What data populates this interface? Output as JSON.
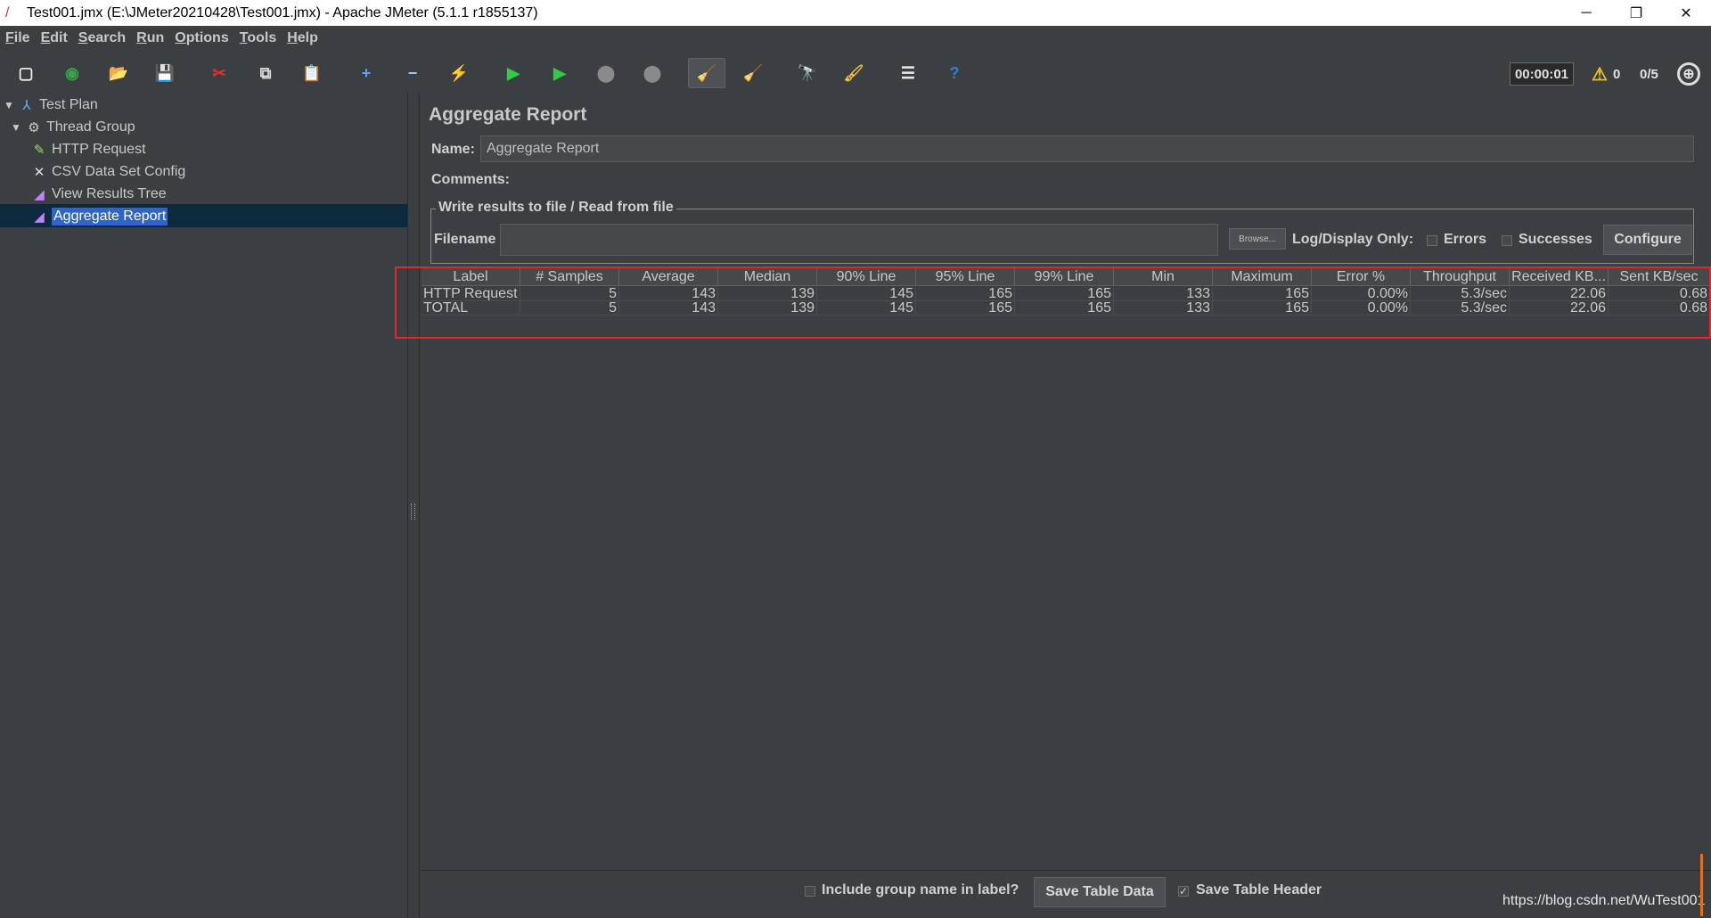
{
  "window": {
    "title": "Test001.jmx (E:\\JMeter20210428\\Test001.jmx) - Apache JMeter (5.1.1 r1855137)",
    "minimize": "─",
    "restore": "❐",
    "close": "✕"
  },
  "menu": [
    {
      "label": "File",
      "mnemonic": "F",
      "rest": "ile"
    },
    {
      "label": "Edit",
      "mnemonic": "E",
      "rest": "dit"
    },
    {
      "label": "Search",
      "mnemonic": "S",
      "rest": "earch"
    },
    {
      "label": "Run",
      "mnemonic": "R",
      "rest": "un"
    },
    {
      "label": "Options",
      "mnemonic": "O",
      "rest": "ptions"
    },
    {
      "label": "Tools",
      "mnemonic": "T",
      "rest": "ools"
    },
    {
      "label": "Help",
      "mnemonic": "H",
      "rest": "elp"
    }
  ],
  "toolbar": {
    "icons": [
      "new-icon",
      "templates-icon",
      "open-icon",
      "save-icon",
      "cut-icon",
      "copy-icon",
      "paste-icon",
      "expand-icon",
      "collapse-icon",
      "toggle-icon",
      "start-icon",
      "start-no-pause-icon",
      "stop-icon",
      "shutdown-icon",
      "clear-icon",
      "clear-all-icon",
      "search-icon",
      "reset-search-icon",
      "function-helper-icon",
      "help-icon"
    ],
    "glyphs": [
      "▢",
      "◉",
      "📂",
      "💾",
      "✂",
      "⧉",
      "📋",
      "+",
      "−",
      "⚡",
      "▶",
      "▶",
      "⬤",
      "⬤",
      "🧹",
      "🧹",
      "🔭",
      "🖌",
      "☰",
      "?"
    ],
    "timer": "00:00:01",
    "warnings": "0",
    "threads": "0/5"
  },
  "tree": {
    "items": [
      {
        "label": "Test Plan",
        "icon": "test-plan-icon"
      },
      {
        "label": "Thread Group",
        "icon": "gear-icon"
      },
      {
        "label": "HTTP Request",
        "icon": "pipette-icon"
      },
      {
        "label": "CSV Data Set Config",
        "icon": "wrench-icon"
      },
      {
        "label": "View Results Tree",
        "icon": "graph-icon"
      },
      {
        "label": "Aggregate Report",
        "icon": "graph-icon"
      }
    ]
  },
  "panel": {
    "title": "Aggregate Report",
    "name_label": "Name:",
    "name_value": "Aggregate Report",
    "comments_label": "Comments:",
    "fieldset_legend": "Write results to file / Read from file",
    "filename_label": "Filename",
    "browse_label": "Browse...",
    "log_display_only": "Log/Display Only:",
    "errors_label": "Errors",
    "successes_label": "Successes",
    "configure_label": "Configure"
  },
  "table": {
    "columns": [
      "Label",
      "# Samples",
      "Average",
      "Median",
      "90% Line",
      "95% Line",
      "99% Line",
      "Min",
      "Maximum",
      "Error %",
      "Throughput",
      "Received KB...",
      "Sent KB/sec"
    ],
    "rows": [
      [
        "HTTP Request",
        "5",
        "143",
        "139",
        "145",
        "165",
        "165",
        "133",
        "165",
        "0.00%",
        "5.3/sec",
        "22.06",
        "0.68"
      ],
      [
        "TOTAL",
        "5",
        "143",
        "139",
        "145",
        "165",
        "165",
        "133",
        "165",
        "0.00%",
        "5.3/sec",
        "22.06",
        "0.68"
      ]
    ]
  },
  "bottom": {
    "include_group_label": "Include group name in label?",
    "save_table_data": "Save Table Data",
    "save_table_header": "Save Table Header",
    "save_header_checked": "✓"
  },
  "watermark": "https://blog.csdn.net/WuTest001"
}
